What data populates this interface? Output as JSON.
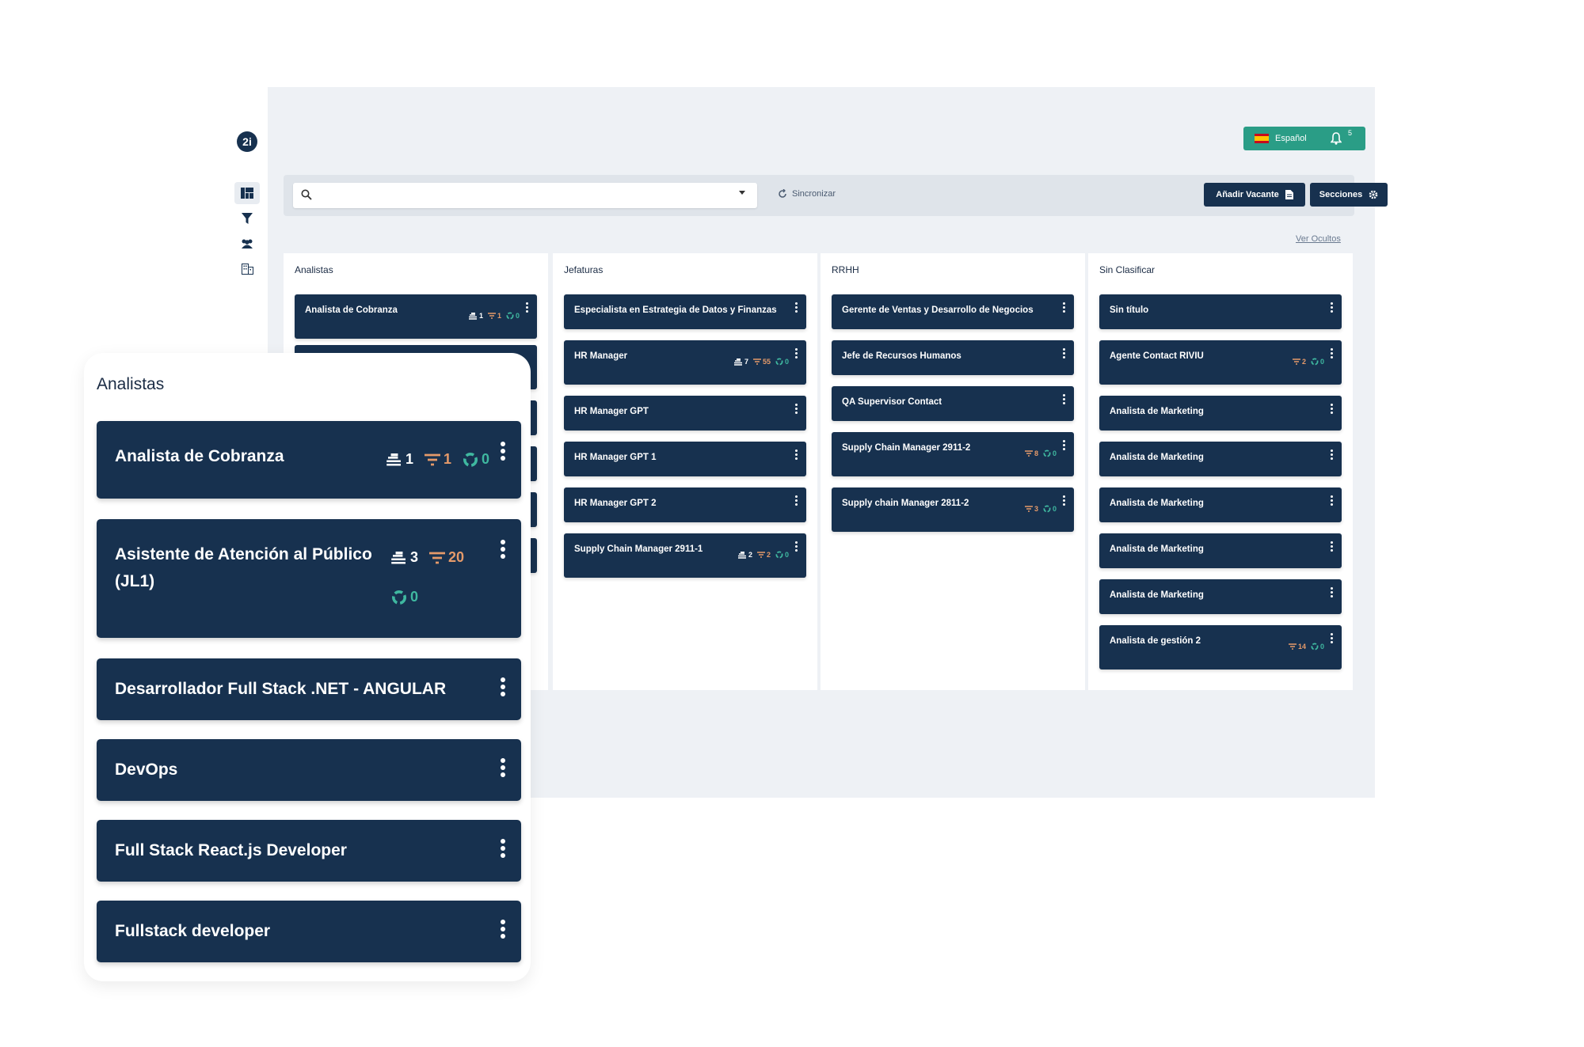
{
  "brand": {
    "logo_text": "2i"
  },
  "sidebar": {
    "items": [
      "dashboard-icon",
      "filter-icon",
      "users-icon",
      "building-icon"
    ]
  },
  "header": {
    "language": "Español",
    "notifications": "5"
  },
  "toolbar": {
    "search_placeholder": "",
    "sync_label": "Sincronizar",
    "add_vacancy_label": "Añadir Vacante",
    "sections_label": "Secciones"
  },
  "ver_ocultos": "Ver Ocultos",
  "columns": [
    {
      "title": "Analistas",
      "cards": [
        {
          "title": "Analista de Cobranza",
          "people": "1",
          "filter": "1",
          "recycle": "0"
        }
      ]
    },
    {
      "title": "Jefaturas",
      "cards": [
        {
          "title": "Especialista en Estrategia de Datos y Finanzas"
        },
        {
          "title": "HR Manager",
          "people": "7",
          "filter": "55",
          "recycle": "0"
        },
        {
          "title": "HR Manager GPT"
        },
        {
          "title": "HR Manager GPT 1"
        },
        {
          "title": "HR Manager GPT 2"
        },
        {
          "title": "Supply Chain Manager 2911-1",
          "people": "2",
          "filter": "2",
          "recycle": "0"
        }
      ]
    },
    {
      "title": "RRHH",
      "cards": [
        {
          "title": "Gerente de Ventas y Desarrollo de Negocios"
        },
        {
          "title": "Jefe de Recursos Humanos"
        },
        {
          "title": "QA Supervisor Contact"
        },
        {
          "title": "Supply Chain Manager 2911-2",
          "filter": "8",
          "recycle": "0"
        },
        {
          "title": "Supply chain Manager 2811-2",
          "filter": "3",
          "recycle": "0"
        }
      ]
    },
    {
      "title": "Sin Clasificar",
      "cards": [
        {
          "title": "Sin título"
        },
        {
          "title": "Agente Contact RIVIU",
          "filter": "2",
          "recycle": "0"
        },
        {
          "title": "Analista de Marketing"
        },
        {
          "title": "Analista de Marketing"
        },
        {
          "title": "Analista de Marketing"
        },
        {
          "title": "Analista de Marketing"
        },
        {
          "title": "Analista de Marketing"
        },
        {
          "title": "Analista de gestión 2",
          "filter": "14",
          "recycle": "0"
        }
      ]
    }
  ],
  "zoom": {
    "title": "Analistas",
    "cards": [
      {
        "title": "Analista de Cobranza",
        "people": "1",
        "filter": "1",
        "recycle": "0"
      },
      {
        "title_line1": "Asistente de Atención al Público",
        "title_line2": "(JL1)",
        "people": "3",
        "filter": "20",
        "recycle": "0"
      },
      {
        "title": "Desarrollador Full Stack .NET - ANGULAR"
      },
      {
        "title": "DevOps"
      },
      {
        "title": "Full Stack React.js Developer"
      },
      {
        "title": "Fullstack developer"
      }
    ]
  },
  "colors": {
    "card": "#17314f",
    "accent": "#2a9d86",
    "filter": "#e59a6a",
    "recycle": "#3fb8a0",
    "bg": "#eef1f5"
  }
}
